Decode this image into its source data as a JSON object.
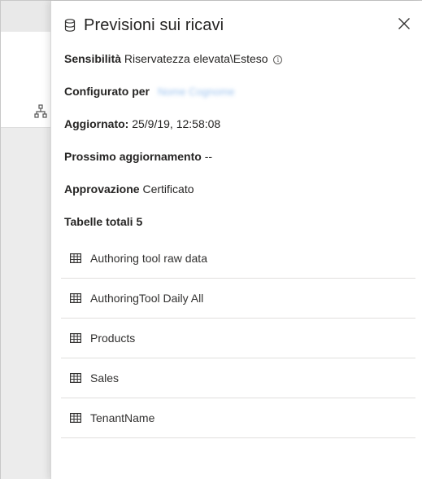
{
  "panel": {
    "title": "Previsioni sui ricavi",
    "header_icon": "database-icon",
    "close_icon": "close-icon"
  },
  "properties": {
    "sensitivity": {
      "label": "Sensibilità",
      "value": "Riservatezza elevata\\Esteso"
    },
    "configured_by": {
      "label": "Configurato per",
      "value": "Nome Cognome"
    },
    "updated": {
      "label": "Aggiornato:",
      "value": "25/9/19, 12:58:08"
    },
    "next_update": {
      "label": "Prossimo aggiornamento",
      "value": "--"
    },
    "approval": {
      "label": "Approvazione",
      "value": "Certificato"
    },
    "tables_total": {
      "label": "Tabelle totali",
      "value": "5"
    }
  },
  "tables": [
    {
      "name": "Authoring tool raw data"
    },
    {
      "name": "AuthoringTool Daily All"
    },
    {
      "name": "Products"
    },
    {
      "name": "Sales"
    },
    {
      "name": "TenantName"
    }
  ],
  "colors": {
    "accent_link": "#9cc2ee",
    "divider": "#e1dfdd"
  }
}
